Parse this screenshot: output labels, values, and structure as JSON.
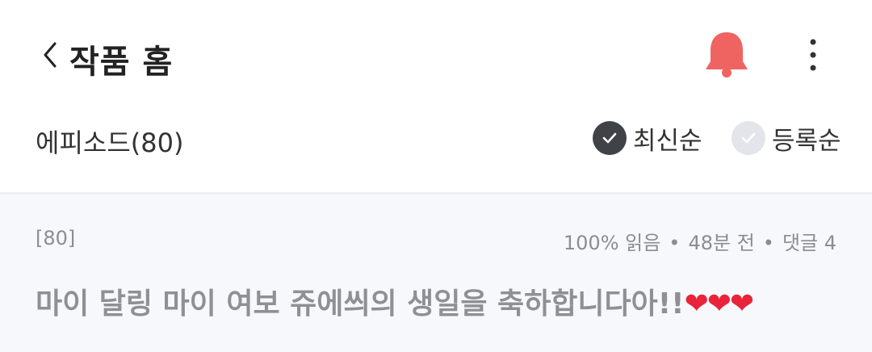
{
  "header": {
    "back_icon": "chevron-left-icon",
    "title": "작품 홈",
    "notify_icon": "bell-icon",
    "notify_color": "#ef6461",
    "more_icon": "more-vertical-icon"
  },
  "episodes_bar": {
    "label": "에피소드(80)",
    "sort_options": [
      {
        "label": "최신순",
        "selected": true,
        "icon": "check-circle-icon",
        "color": "#3f4247"
      },
      {
        "label": "등록순",
        "selected": false,
        "icon": "check-circle-icon",
        "color": "#e3e5ea"
      }
    ]
  },
  "episodes": [
    {
      "number": "[80]",
      "read": "100% 읽음",
      "time": "48분 전",
      "comments": "댓글 4",
      "title": "마이 달링 마이 여보 쥬에씌의 생일을 축하합니다아!!",
      "hearts": "❤❤❤"
    }
  ]
}
